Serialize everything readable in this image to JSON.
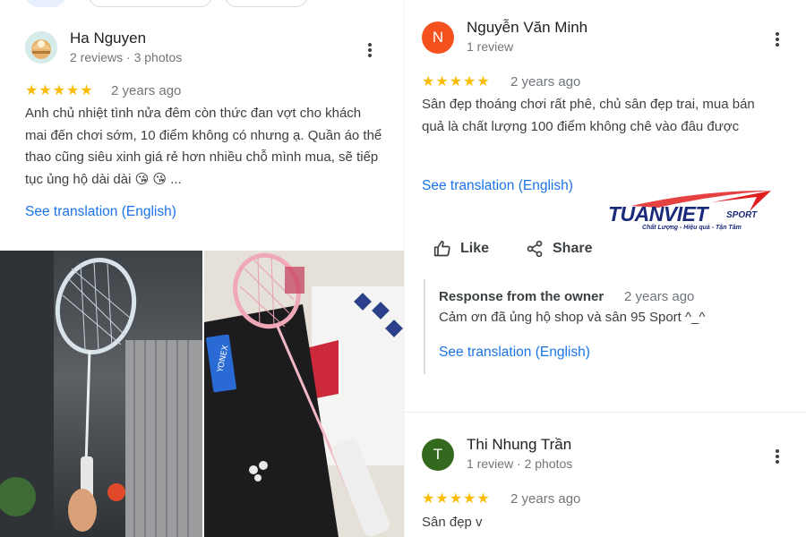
{
  "reviews": [
    {
      "author": "Ha Nguyen",
      "avatar_style": "photo",
      "meta": "2 reviews · 3 photos",
      "stars": "★★★★★",
      "date": "2 years ago",
      "text": "Anh chủ nhiệt tình nửa đêm còn thức đan vợt cho khách mai đến chơi sớm, 10 điểm không có nhưng ạ. Quần áo thể thao cũng siêu xinh giá rẻ hơn nhiều chỗ mình mua, sẽ tiếp tục ủng hộ dài dài 😘 😘 ...",
      "translate_link": "See translation (English)"
    },
    {
      "author": "Nguyễn Văn Minh",
      "avatar_letter": "N",
      "avatar_color": "#f4511e",
      "meta": "1 review",
      "stars": "★★★★★",
      "date": "2 years ago",
      "text": "Sân đẹp thoáng chơi rất phê, chủ sân đẹp trai, mua bán quả là chất lượng 100 điểm không chê vào đâu được",
      "translate_link": "See translation (English)",
      "like_label": "Like",
      "share_label": "Share",
      "owner_response": {
        "title": "Response from the owner",
        "date": "2 years ago",
        "text": "Cảm ơn đã ủng hộ shop và sân 95 Sport ^_^",
        "translate_link": "See translation (English)"
      }
    },
    {
      "author": "Thi Nhung Trần",
      "avatar_letter": "T",
      "avatar_color": "#33691e",
      "meta": "1 review · 2 photos",
      "stars": "★★★★★",
      "date": "2 years ago",
      "text": "Sân đẹp v"
    }
  ],
  "logo": {
    "brand": "TUANVIET",
    "sub": "SPORT",
    "tagline": "Chất Lượng - Hiệu quả - Tận Tâm"
  },
  "colors": {
    "star": "#fbbc04",
    "link": "#1a73e8",
    "logo_blue": "#1a2a7a",
    "logo_red": "#e02020"
  }
}
